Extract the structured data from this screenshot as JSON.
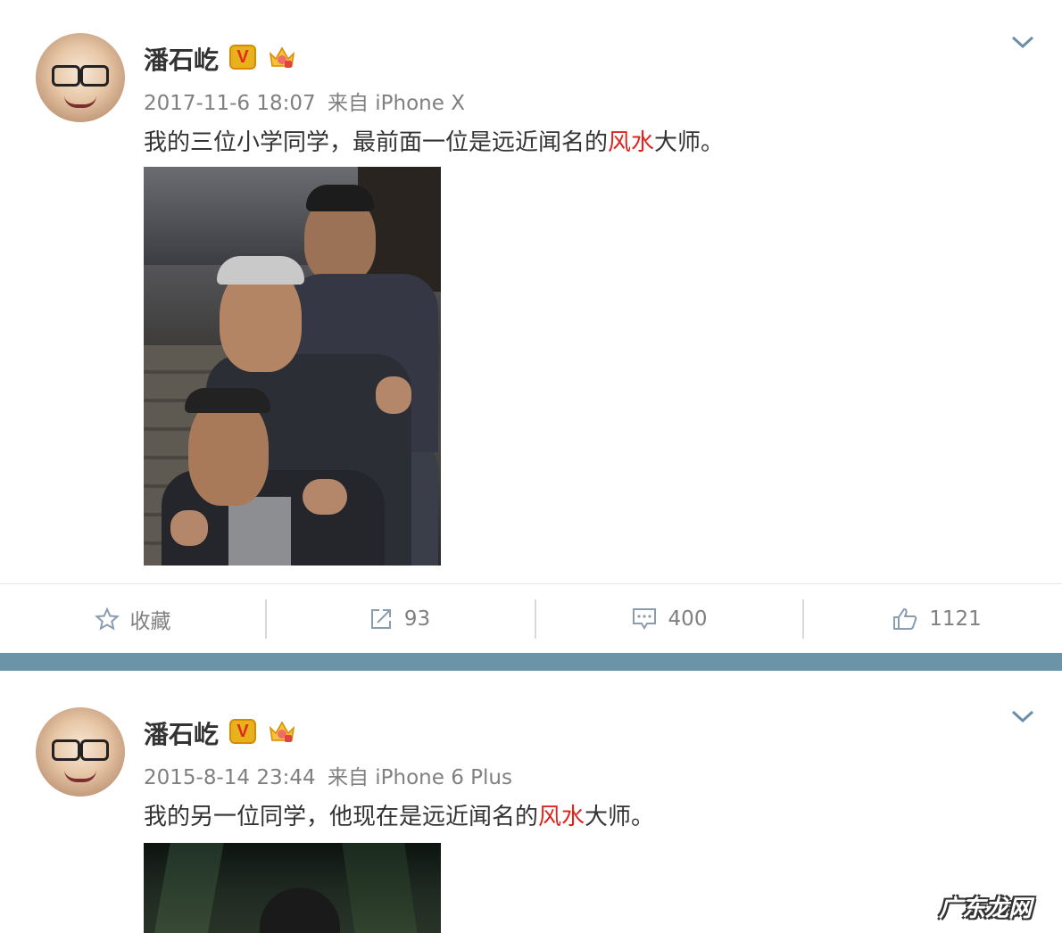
{
  "posts": [
    {
      "username": "潘石屹",
      "verified_badge": "V",
      "timestamp": "2017-11-6 18:07",
      "source_prefix": "来自",
      "source": "iPhone X",
      "text_before": "我的三位小学同学，最前面一位是远近闻名的",
      "keyword": "风水",
      "text_after": "大师。",
      "actions": {
        "favorite_label": "收藏",
        "repost_count": "93",
        "comment_count": "400",
        "like_count": "1121"
      }
    },
    {
      "username": "潘石屹",
      "verified_badge": "V",
      "timestamp": "2015-8-14 23:44",
      "source_prefix": "来自",
      "source": "iPhone 6 Plus",
      "text_before": "我的另一位同学，他现在是远近闻名的",
      "keyword": "风水",
      "text_after": "大师。"
    }
  ],
  "watermark": "广东龙网",
  "colors": {
    "keyword": "#e0251d",
    "meta": "#808080",
    "divider_band": "#6b94a8",
    "badge_gold": "#e8b21c"
  },
  "icons": [
    "chevron-down-icon",
    "star-icon",
    "repost-icon",
    "comment-icon",
    "thumbs-up-icon",
    "crown-icon"
  ]
}
